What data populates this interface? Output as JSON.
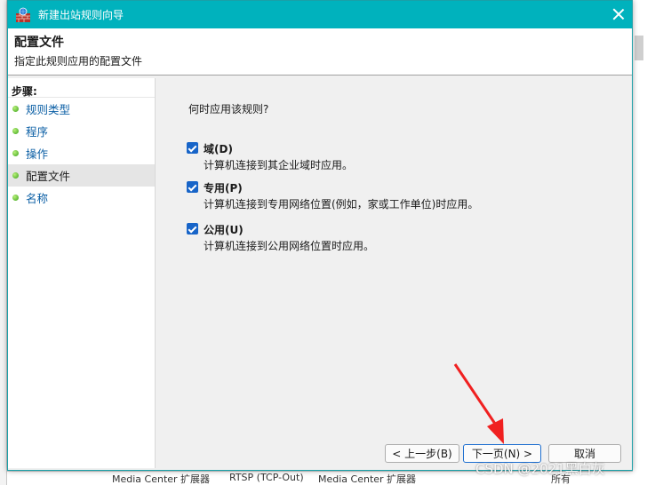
{
  "window": {
    "title": "新建出站规则向导",
    "close_glyph": ""
  },
  "header": {
    "title": "配置文件",
    "subtitle": "指定此规则应用的配置文件"
  },
  "steps": {
    "title": "步骤:",
    "items": [
      {
        "label": "规则类型",
        "current": false
      },
      {
        "label": "程序",
        "current": false
      },
      {
        "label": "操作",
        "current": false
      },
      {
        "label": "配置文件",
        "current": true
      },
      {
        "label": "名称",
        "current": false
      }
    ]
  },
  "content": {
    "question": "何时应用该规则?",
    "options": [
      {
        "label": "域(D)",
        "description": "计算机连接到其企业域时应用。",
        "checked": true
      },
      {
        "label": "专用(P)",
        "description": "计算机连接到专用网络位置(例如，家或工作单位)时应用。",
        "checked": true
      },
      {
        "label": "公用(U)",
        "description": "计算机连接到公用网络位置时应用。",
        "checked": true
      }
    ]
  },
  "buttons": {
    "back": "< 上一步(B)",
    "next": "下一页(N) >",
    "cancel": "取消"
  },
  "background": {
    "bottom_text_left": "Media Center 扩展器",
    "bottom_text_mid": "RTSP (TCP-Out)",
    "bottom_text_right": "Media Center 扩展器",
    "bottom_text_far": "所有"
  },
  "watermark": "CSDN @2021黑白灰",
  "colors": {
    "titlebar": "#00b2bd",
    "checkbox": "#1764c8",
    "link": "#0b5fa5",
    "annotation_arrow": "#f02020"
  },
  "icons": {
    "app": "firewall-icon",
    "step": "green-dot-icon",
    "checkbox": "checkmark-icon",
    "close": "close-icon"
  }
}
